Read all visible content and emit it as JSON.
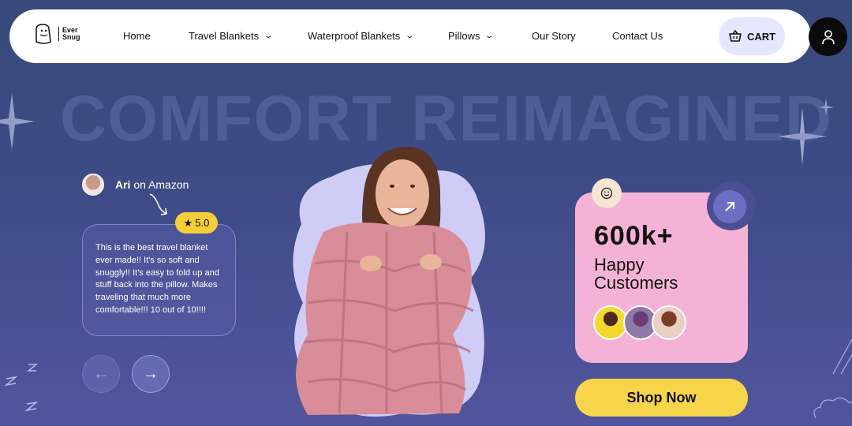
{
  "brand": {
    "line1": "Ever",
    "line2": "Snug"
  },
  "nav": {
    "items": [
      {
        "label": "Home",
        "dropdown": false
      },
      {
        "label": "Travel Blankets",
        "dropdown": true
      },
      {
        "label": "Waterproof Blankets",
        "dropdown": true
      },
      {
        "label": "Pillows",
        "dropdown": true
      },
      {
        "label": "Our Story",
        "dropdown": false
      },
      {
        "label": "Contact Us",
        "dropdown": false
      }
    ],
    "cart_label": "CART"
  },
  "hero": {
    "headline": "COMFORT REIMAGINED"
  },
  "review": {
    "name": "Ari",
    "source": "on Amazon",
    "rating": "5.0",
    "text": "This is the best travel blanket ever made!! It's so soft and snuggly!! It's easy to fold up and stuff back into the pillow. Makes traveling that much more comfortable!!! 10 out of 10!!!!"
  },
  "stats": {
    "number": "600k+",
    "label": "Happy Customers"
  },
  "cta": {
    "shop_label": "Shop Now"
  },
  "colors": {
    "accent_yellow": "#f6d54a",
    "card_pink": "#f4b3d6",
    "bubble_lavender": "#cfccf5"
  },
  "icons": [
    "cart-icon",
    "user-icon",
    "star-icon",
    "arrow-left-icon",
    "arrow-right-icon",
    "arrow-up-right-icon",
    "smiley-icon"
  ]
}
